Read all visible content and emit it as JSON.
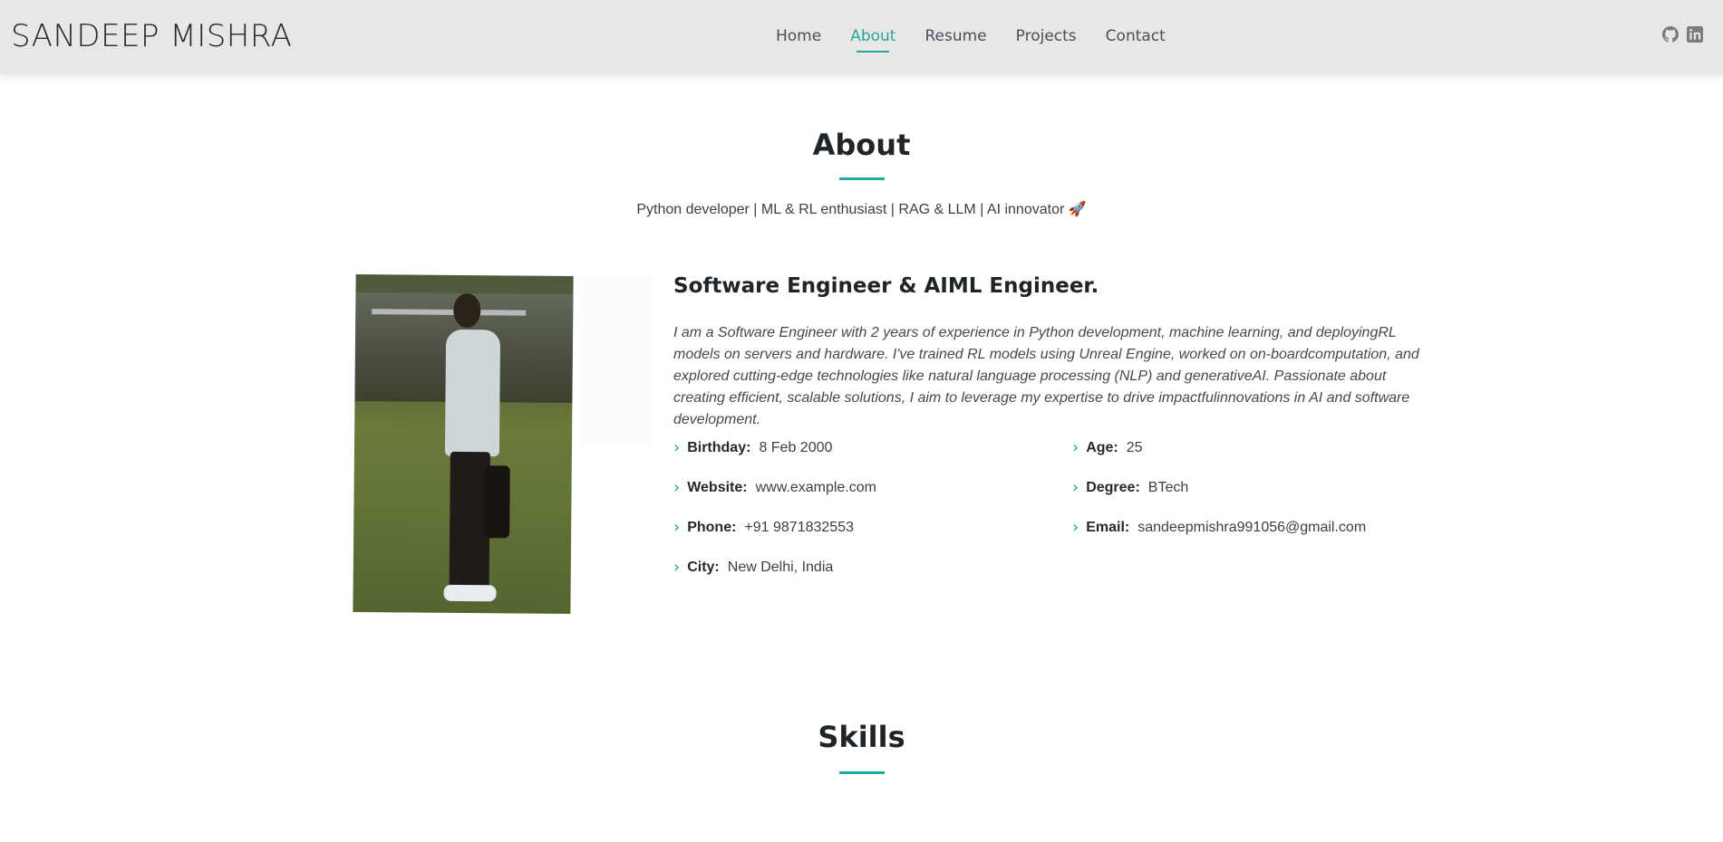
{
  "header": {
    "logo": "SANDEEP MISHRA",
    "nav": [
      {
        "label": "Home",
        "active": false
      },
      {
        "label": "About",
        "active": true
      },
      {
        "label": "Resume",
        "active": false
      },
      {
        "label": "Projects",
        "active": false
      },
      {
        "label": "Contact",
        "active": false
      }
    ],
    "social_icons": [
      "github-icon",
      "linkedin-icon"
    ]
  },
  "about": {
    "title": "About",
    "tagline": "Python developer | ML & RL enthusiast | RAG & LLM | AI innovator",
    "tagline_emoji": "🚀",
    "heading": "Software Engineer & AIML Engineer.",
    "intro": "I am a Software Engineer with 2 years of experience in Python development, machine learning, and deployingRL models on servers and hardware. I've trained RL models using Unreal Engine, worked on on-boardcomputation, and explored cutting-edge technologies like natural language processing (NLP) and generativeAI. Passionate about creating efficient, scalable solutions, I aim to leverage my expertise to drive impactfulinnovations in AI and software development.",
    "facts_left": [
      {
        "label": "Birthday:",
        "value": "8 Feb 2000"
      },
      {
        "label": "Website:",
        "value": "www.example.com"
      },
      {
        "label": "Phone:",
        "value": "+91 9871832553"
      },
      {
        "label": "City:",
        "value": "New Delhi, India"
      }
    ],
    "facts_right": [
      {
        "label": "Age:",
        "value": "25"
      },
      {
        "label": "Degree:",
        "value": "BTech"
      },
      {
        "label": "Email:",
        "value": "sandeepmishra991056@gmail.com"
      }
    ]
  },
  "skills": {
    "title": "Skills"
  },
  "colors": {
    "accent": "#21a8a0",
    "header_bg": "#e8e7e5",
    "text": "#272829"
  }
}
